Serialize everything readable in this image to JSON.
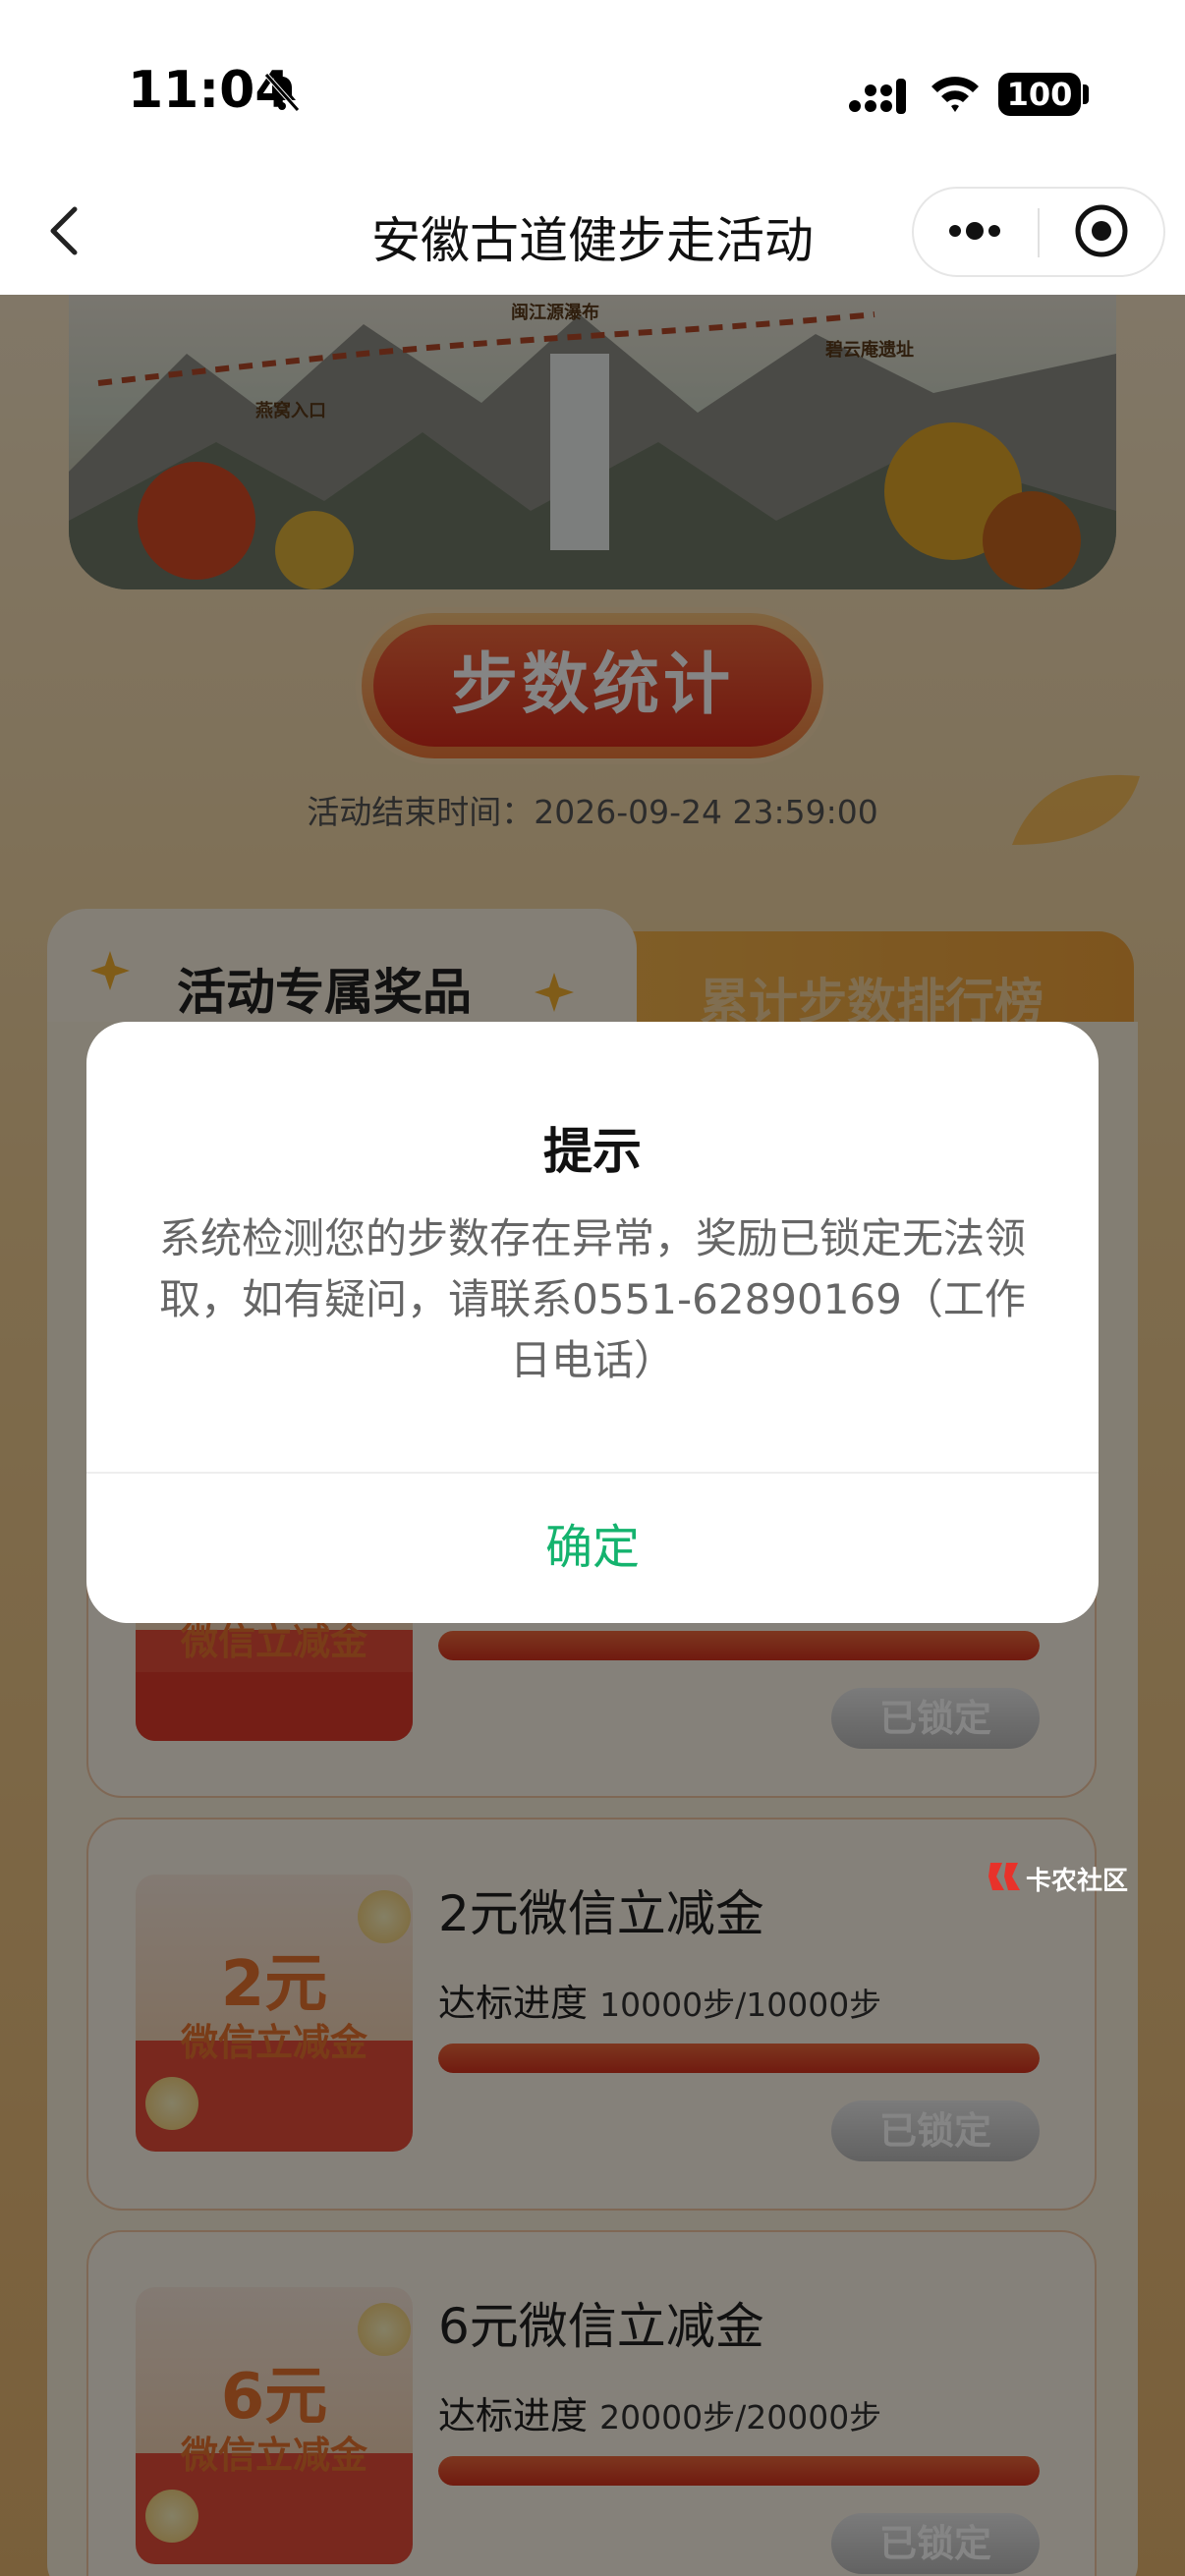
{
  "status_bar": {
    "time": "11:04",
    "battery": "100"
  },
  "nav": {
    "title": "安徽古道健步走活动"
  },
  "hero": {
    "labels": [
      "闽江源瀑布",
      "碧云庵遗址",
      "燕窝入口"
    ]
  },
  "stats_button": {
    "label": "步数统计"
  },
  "end_time": "活动结束时间：2026-09-24 23:59:00",
  "tabs": {
    "active": "活动专属奖品",
    "inactive": "累计步数排行榜"
  },
  "rewards": [
    {
      "title": "",
      "amount": "",
      "coupon_label": "微信立减金",
      "progress_label": "",
      "progress_value": "",
      "progress": 1.0,
      "button": "已锁定"
    },
    {
      "title": "2元微信立减金",
      "amount": "2元",
      "coupon_label": "微信立减金",
      "progress_label": "达标进度",
      "progress_value": "10000步/10000步",
      "progress": 1.0,
      "button": "已锁定"
    },
    {
      "title": "6元微信立减金",
      "amount": "6元",
      "coupon_label": "微信立减金",
      "progress_label": "达标进度",
      "progress_value": "20000步/20000步",
      "progress": 1.0,
      "button": "已锁定"
    }
  ],
  "dialog": {
    "title": "提示",
    "message": "系统检测您的步数存在异常，奖励已锁定无法领取，如有疑问，请联系0551-62890169（工作日电话）",
    "confirm": "确定"
  },
  "watermark": "卡农社区",
  "colors": {
    "confirm": "#14b36e",
    "accent": "#e03a2b"
  }
}
